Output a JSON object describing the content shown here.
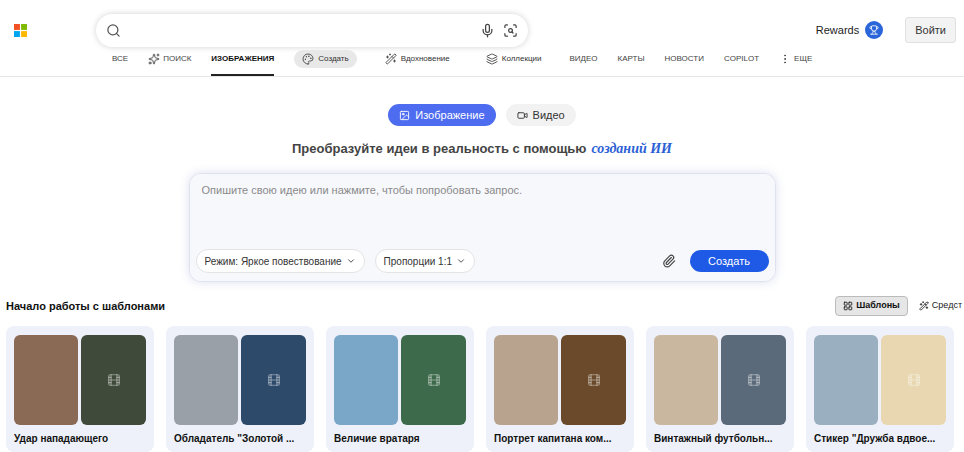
{
  "header": {
    "rewards": "Rewards",
    "signIn": "Войти"
  },
  "nav": [
    {
      "label": "ВСЕ",
      "kind": "tab",
      "selected": false
    },
    {
      "label": "ПОИСК",
      "kind": "copilot",
      "selected": false
    },
    {
      "label": "ИЗОБРАЖЕНИЯ",
      "kind": "tab",
      "selected": true
    },
    {
      "label": "Создать",
      "kind": "create",
      "selected": true
    },
    {
      "label": "Вдохновение",
      "kind": "inspire",
      "selected": false
    },
    {
      "label": "Коллекции",
      "kind": "collections",
      "selected": false
    },
    {
      "label": "ВИДЕО",
      "kind": "tab",
      "selected": false
    },
    {
      "label": "КАРТЫ",
      "kind": "tab",
      "selected": false
    },
    {
      "label": "НОВОСТИ",
      "kind": "tab",
      "selected": false
    },
    {
      "label": "COPILOT",
      "kind": "tab",
      "selected": false
    },
    {
      "label": "ЕЩЕ",
      "kind": "more",
      "selected": false
    }
  ],
  "modeToggle": [
    {
      "label": "Изображение",
      "selected": true
    },
    {
      "label": "Видео",
      "selected": false
    }
  ],
  "headline": {
    "text": "Преобразуйте идеи в реальность с помощью",
    "highlight": "созданий ИИ"
  },
  "prompt": {
    "placeholder": "Опишите свою идею или нажмите, чтобы попробовать запрос.",
    "mode": "Режим: Яркое повествование",
    "ratio": "Пропорции 1:1",
    "submit": "Создать"
  },
  "templates": {
    "title": "Начало работы с шаблонами",
    "filters": [
      {
        "label": "Шаблоны",
        "selected": true
      },
      {
        "label": "Средст",
        "selected": false
      }
    ],
    "cards": [
      {
        "title": "Удар нападающего"
      },
      {
        "title": "Обладатель \"Золотой ..."
      },
      {
        "title": "Величие вратаря"
      },
      {
        "title": "Портрет капитана ком..."
      },
      {
        "title": "Винтажный футбольн..."
      },
      {
        "title": "Стикер \"Дружба вдвое..."
      }
    ]
  }
}
